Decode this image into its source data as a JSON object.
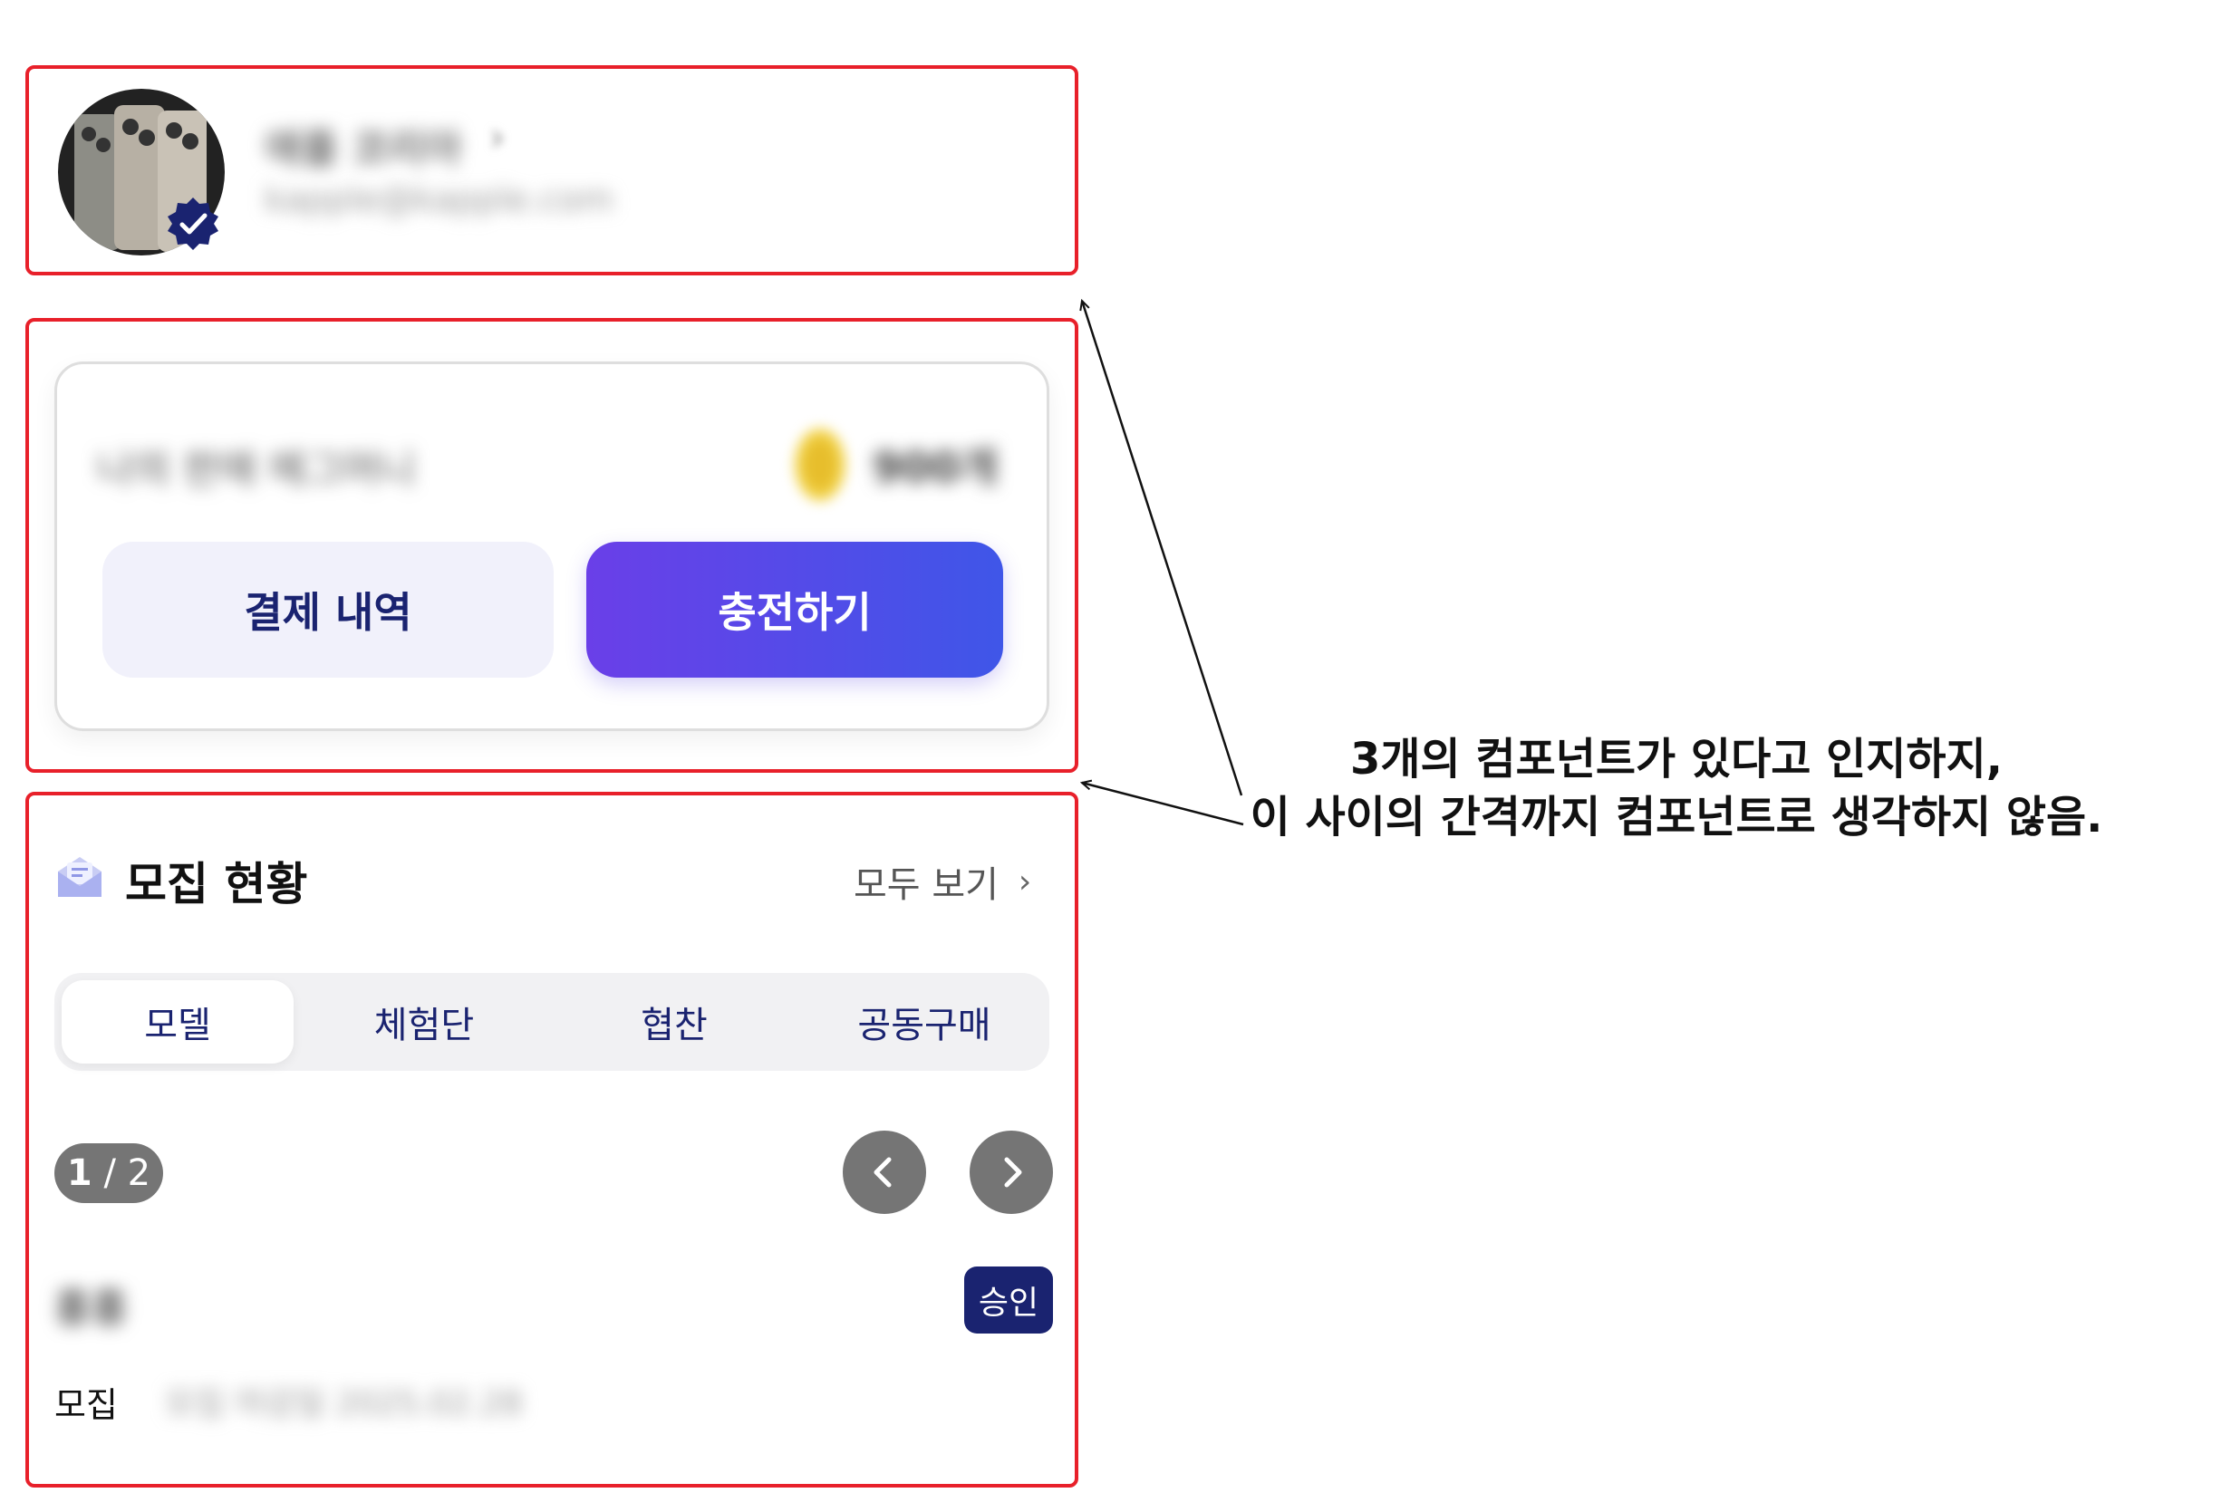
{
  "profile": {
    "name": "애플 코리아",
    "email": "kapple@kapple.com",
    "avatar_icon": "phone-photo-avatar",
    "verified_icon": "verified-badge-icon"
  },
  "wallet": {
    "balance_label": "나의 판매 메그머니",
    "balance_amount": "900개",
    "coin_icon": "coin-icon",
    "history_button": "결제 내역",
    "charge_button": "충전하기"
  },
  "recruitment": {
    "icon": "envelope-icon",
    "title": "모집 현황",
    "view_all": "모두 보기",
    "tabs": [
      {
        "label": "모델",
        "active": true
      },
      {
        "label": "체험단",
        "active": false
      },
      {
        "label": "협찬",
        "active": false
      },
      {
        "label": "공동구매",
        "active": false
      }
    ],
    "pager": {
      "current": "1",
      "separator": " / ",
      "total": "2"
    },
    "item": {
      "title": "홍홍",
      "status_badge": "승인",
      "recruit_label": "모집",
      "deadline": "모집 마감일 2025.02.28"
    }
  },
  "annotation": {
    "line1": "3개의 컴포넌트가 있다고 인지하지,",
    "line2": "이 사이의 간격까지 컴포넌트로 생각하지 않음."
  },
  "colors": {
    "highlight_border": "#e8202a",
    "primary_navy": "#1a2370",
    "charge_gradient_start": "#6a3fe8",
    "charge_gradient_end": "#3f56e8"
  }
}
